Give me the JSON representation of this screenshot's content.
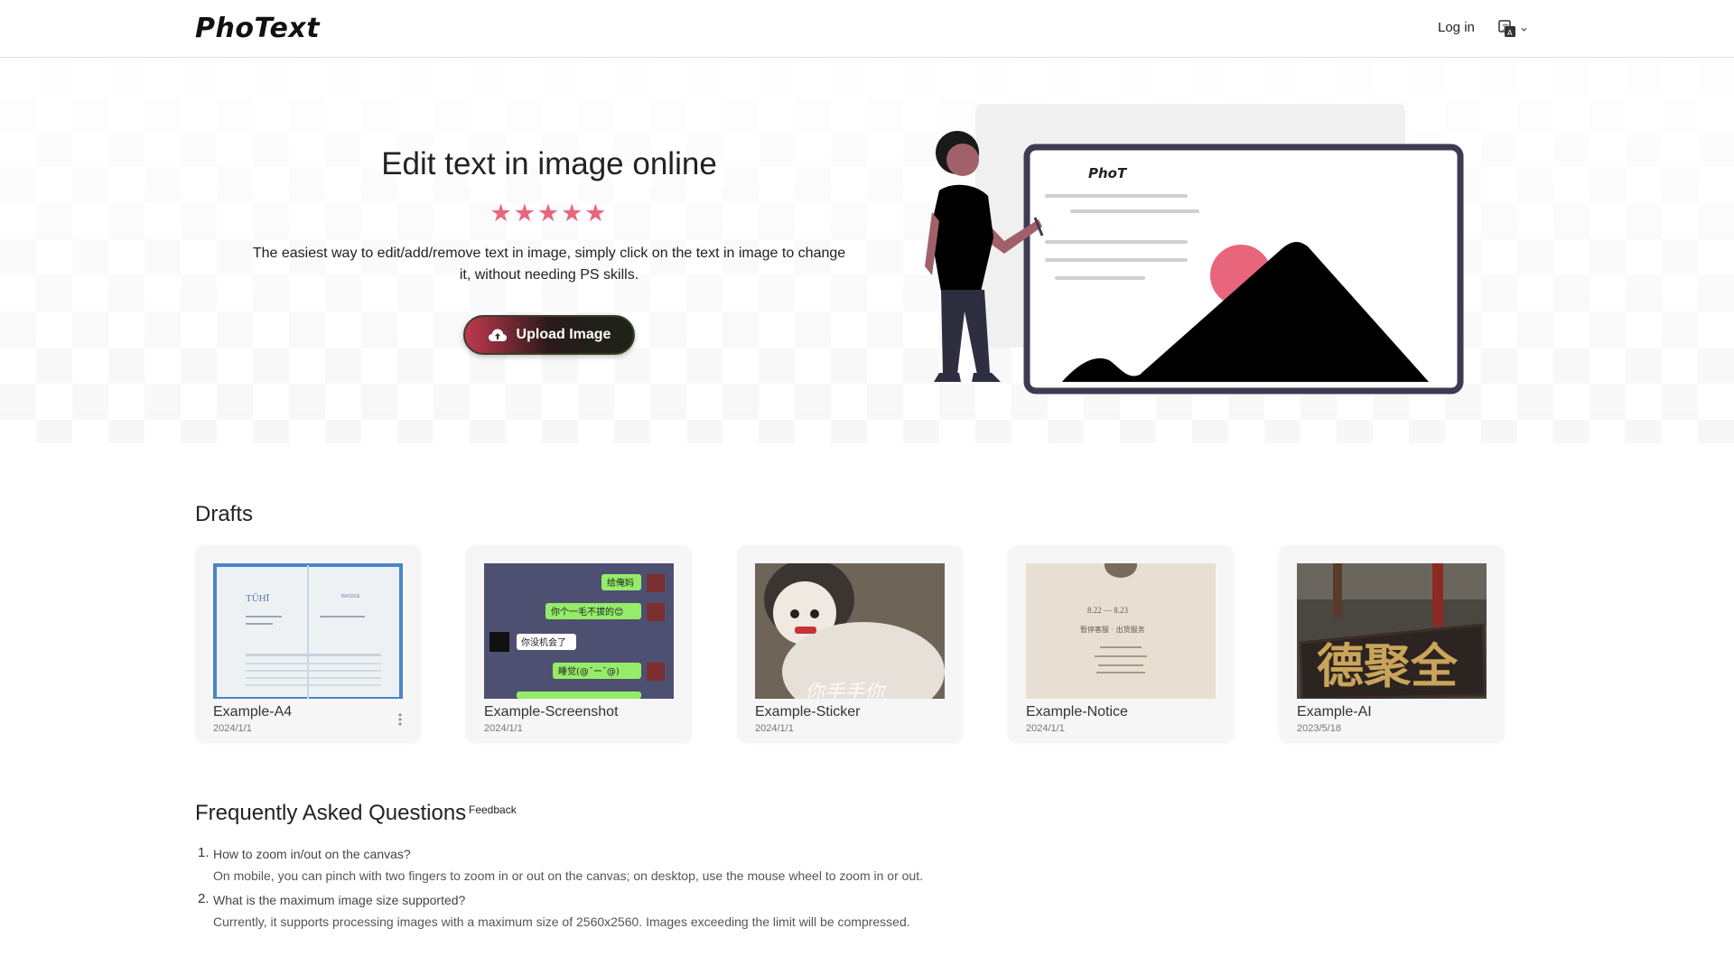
{
  "header": {
    "logo": "PhoText",
    "login_label": "Log in",
    "language_icon": "translate-icon"
  },
  "hero": {
    "title": "Edit text in image online",
    "stars": "★★★★★",
    "description": "The easiest way to edit/add/remove text in image, simply click on the text in image to change it, without needing PS skills.",
    "upload_label": "Upload Image",
    "upload_icon": "cloud-upload-icon",
    "illustration_logo": "PhoT",
    "colors": {
      "accent": "#e8667c",
      "frame": "#3f3a52"
    }
  },
  "drafts": {
    "title": "Drafts",
    "items": [
      {
        "title": "Example-A4",
        "date": "2024/1/1"
      },
      {
        "title": "Example-Screenshot",
        "date": "2024/1/1"
      },
      {
        "title": "Example-Sticker",
        "date": "2024/1/1"
      },
      {
        "title": "Example-Notice",
        "date": "2024/1/1"
      },
      {
        "title": "Example-AI",
        "date": "2023/5/18"
      }
    ],
    "thumb_text": {
      "a4_brand": "TŪHĪ",
      "a4_heading": "INVOICE",
      "chat_1": "给俺妈",
      "chat_2": "你个一毛不拔的😊",
      "chat_3": "你没机会了",
      "chat_4": "睡觉(@¯ー¯@)",
      "sticker_text": "你手手你",
      "notice_date": "8.22 — 8.23",
      "notice_line": "暂停客服 · 出货服务",
      "sign_text": "德聚全"
    }
  },
  "faq": {
    "title": "Frequently Asked Questions",
    "feedback_label": "Feedback",
    "items": [
      {
        "num": "1.",
        "question": "How to zoom in/out on the canvas?",
        "answer": "On mobile, you can pinch with two fingers to zoom in or out on the canvas; on desktop, use the mouse wheel to zoom in or out."
      },
      {
        "num": "2.",
        "question": "What is the maximum image size supported?",
        "answer": "Currently, it supports processing images with a maximum size of 2560x2560. Images exceeding the limit will be compressed."
      }
    ]
  }
}
